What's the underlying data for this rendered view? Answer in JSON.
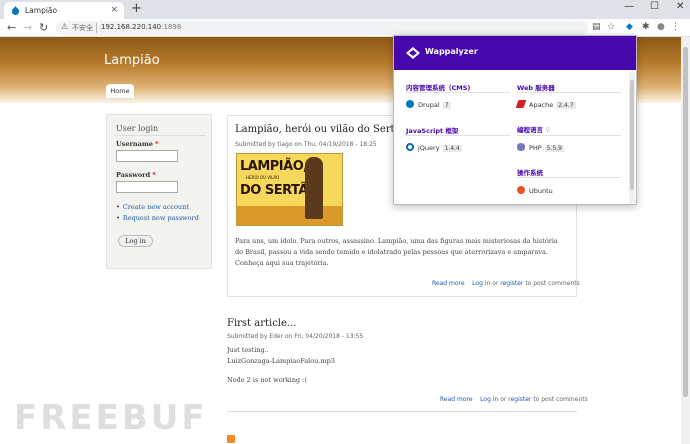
{
  "browser": {
    "tab_title": "Lampião",
    "tab_close": "×",
    "new_tab": "+",
    "window_controls": [
      "—",
      "☐",
      "✕"
    ],
    "not_secure": "不安全",
    "url_host": "192.168.220.140",
    "url_port": ":1898"
  },
  "site": {
    "name": "Lampião",
    "nav_home": "Home"
  },
  "login_block": {
    "title": "User login",
    "username_label": "Username",
    "password_label": "Password",
    "required_mark": "*",
    "links": [
      "Create new account",
      "Request new password"
    ],
    "button": "Log in"
  },
  "articles": [
    {
      "title": "Lampião, herói ou vilão do Sertão?",
      "submitted": "Submitted by tiago on Thu, 04/19/2018 - 18:25",
      "poster_line1": "LAMPIÃO,",
      "poster_small": "HERÓI OU VILÃO",
      "poster_line2": "DO SERTÃO",
      "body": "Para uns, um ídolo. Para outros, assassino. Lampião, uma das figuras mais misteriosas da história do Brasil, passou a vida sendo temido e idolatrado pelas pessoas que aterrorizava e amparava. Conheça aqui sua trajetória.",
      "read_more": "Read more",
      "login": "Log in",
      "or": "or",
      "register": "register",
      "to_post": "to post comments"
    },
    {
      "title": "First article...",
      "submitted": "Submitted by Eder on Fri, 04/20/2018 - 13:55",
      "line1": "Just testing..",
      "line2": "LuizGonzaga-LampiaoFalou.mp3",
      "line3": "Node 2 is not working :(",
      "read_more": "Read more",
      "login": "Log in",
      "or": "or",
      "register": "register",
      "to_post": "to post comments"
    }
  ],
  "watermark": "FREEBUF",
  "wappalyzer": {
    "brand": "Wappalyzer",
    "accent": "#4608ad",
    "categories": [
      {
        "name": "内容管理系统（CMS)",
        "tech": "Drupal",
        "version": "7",
        "icon": "drupal-icon"
      },
      {
        "name": "Web 服务器",
        "tech": "Apache",
        "version": "2.4.7",
        "icon": "apache-feather-icon"
      },
      {
        "name": "JavaScript 框架",
        "tech": "jQuery",
        "version": "1.4.4",
        "icon": "jquery-icon"
      },
      {
        "name": "编程语言",
        "tech": "PHP",
        "version": "5.5.9",
        "icon": "php-icon"
      },
      {
        "name": "操作系统",
        "tech": "Ubuntu",
        "version": "",
        "icon": "ubuntu-icon"
      }
    ]
  }
}
